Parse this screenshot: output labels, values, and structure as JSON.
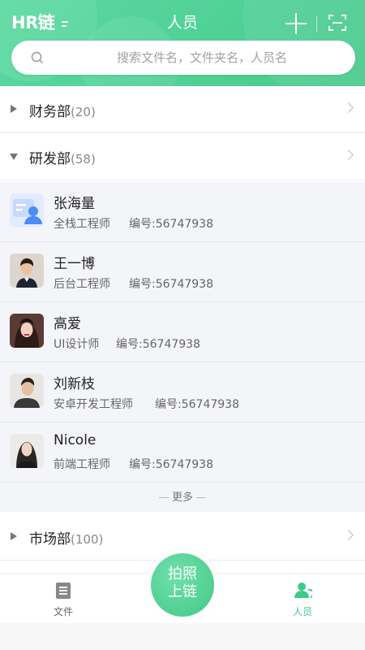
{
  "header": {
    "logo": "HR链",
    "title": "人员"
  },
  "search": {
    "placeholder": "搜索文件名，文件夹名，人员名"
  },
  "departments": [
    {
      "name": "财务部",
      "count": "(20)"
    },
    {
      "name": "研发部",
      "count": "(58)"
    },
    {
      "name": "市场部",
      "count": "(100)"
    }
  ],
  "members": [
    {
      "name": "张海量",
      "role": "全栈工程师",
      "id": "编号:56747938"
    },
    {
      "name": "王一博",
      "role": "后台工程师",
      "id": "编号:56747938"
    },
    {
      "name": "高爱",
      "role": "UI设计师",
      "id": "编号:56747938"
    },
    {
      "name": "刘新枝",
      "role": "安卓开发工程师",
      "id": "编号:56747938"
    },
    {
      "name": "Nicole",
      "role": "前端工程师",
      "id": "编号:56747938"
    }
  ],
  "more": "更多",
  "tabbar": {
    "files": "文件",
    "people": "人员",
    "fab_line1": "拍照",
    "fab_line2": "上链"
  },
  "colors": {
    "accent": "#4fd095",
    "active_tab": "#3fc98a"
  },
  "icons": [
    "menu-lines-icon",
    "plus-icon",
    "scan-icon",
    "search-icon",
    "caret-right-icon",
    "caret-down-icon",
    "chevron-right-icon",
    "document-icon",
    "person-icon"
  ]
}
